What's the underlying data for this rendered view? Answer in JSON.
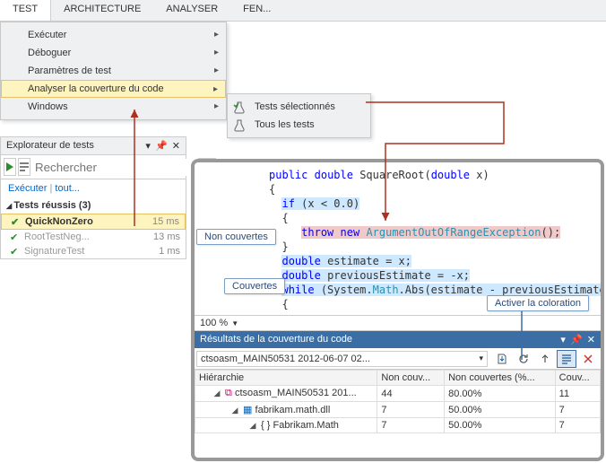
{
  "menubar": {
    "tabs": [
      "TEST",
      "ARCHITECTURE",
      "ANALYSER",
      "FEN..."
    ]
  },
  "dropdown": {
    "items": [
      {
        "label": "Exécuter",
        "sub": true
      },
      {
        "label": "Déboguer",
        "sub": true
      },
      {
        "label": "Paramètres de test",
        "sub": true
      },
      {
        "label": "Analyser la couverture du code",
        "sub": true,
        "hl": true
      },
      {
        "label": "Windows",
        "sub": true
      }
    ]
  },
  "submenu": {
    "items": [
      {
        "label": "Tests sélectionnés"
      },
      {
        "label": "Tous les tests"
      }
    ]
  },
  "test_explorer": {
    "title": "Explorateur de tests",
    "search_placeholder": "Rechercher",
    "links_execute": "Exécuter",
    "links_all": "tout...",
    "section": "Tests réussis (3)",
    "rows": [
      {
        "name": "QuickNonZero",
        "time": "15 ms",
        "sel": true
      },
      {
        "name": "RootTestNeg...",
        "time": "13 ms",
        "dim": true
      },
      {
        "name": "SignatureTest",
        "time": "1 ms",
        "dim": true
      }
    ]
  },
  "code": {
    "lines": [
      [
        {
          "t": "         "
        },
        {
          "t": "public",
          "c": "kw"
        },
        {
          "t": " "
        },
        {
          "t": "double",
          "c": "kw"
        },
        {
          "t": " SquareRoot("
        },
        {
          "t": "double",
          "c": "kw"
        },
        {
          "t": " x)"
        }
      ],
      [
        {
          "t": "         {"
        }
      ],
      [
        {
          "t": "           "
        },
        {
          "t": "if",
          "c": "kw",
          "h": "cov"
        },
        {
          "t": " (x < 0.0)",
          "h": "cov"
        }
      ],
      [
        {
          "t": "           {"
        }
      ],
      [
        {
          "t": "              "
        },
        {
          "t": "throw",
          "c": "kw",
          "h": "uncov"
        },
        {
          "t": " ",
          "h": "uncov"
        },
        {
          "t": "new",
          "c": "kw",
          "h": "uncov"
        },
        {
          "t": " ",
          "h": "uncov"
        },
        {
          "t": "ArgumentOutOfRangeException",
          "c": "typ",
          "h": "uncov"
        },
        {
          "t": "();",
          "h": "uncov"
        }
      ],
      [
        {
          "t": "           }"
        }
      ],
      [
        {
          "t": "           "
        },
        {
          "t": "double",
          "c": "kw",
          "h": "cov"
        },
        {
          "t": " estimate = x;",
          "h": "cov"
        }
      ],
      [
        {
          "t": "           "
        },
        {
          "t": "double",
          "c": "kw",
          "h": "cov"
        },
        {
          "t": " previousEstimate = -x;",
          "h": "cov"
        }
      ],
      [
        {
          "t": "           "
        },
        {
          "t": "while",
          "c": "kw",
          "h": "cov"
        },
        {
          "t": " (System.",
          "h": "cov"
        },
        {
          "t": "Math",
          "c": "typ",
          "h": "cov"
        },
        {
          "t": ".Abs(estimate - previousEstimate) >...",
          "h": "cov"
        }
      ],
      [
        {
          "t": "           {"
        }
      ]
    ],
    "zoom": "100 %"
  },
  "callouts": {
    "uncov": "Non couvertes",
    "cov": "Couvertes",
    "color": "Activer la coloration"
  },
  "coverage": {
    "title": "Résultats de la couverture du code",
    "combo": "ctsoasm_MAIN50531 2012-06-07 02...",
    "headers": [
      "Hiérarchie",
      "Non couv...",
      "Non couvertes (%...",
      "Couv..."
    ],
    "rows": [
      {
        "indent": 1,
        "icon": "asm",
        "label": "ctsoasm_MAIN50531 201...",
        "c1": "44",
        "c2": "80.00%",
        "c3": "11"
      },
      {
        "indent": 2,
        "icon": "dll",
        "label": "fabrikam.math.dll",
        "c1": "7",
        "c2": "50.00%",
        "c3": "7"
      },
      {
        "indent": 3,
        "icon": "ns",
        "label": "Fabrikam.Math",
        "c1": "7",
        "c2": "50.00%",
        "c3": "7"
      }
    ]
  }
}
